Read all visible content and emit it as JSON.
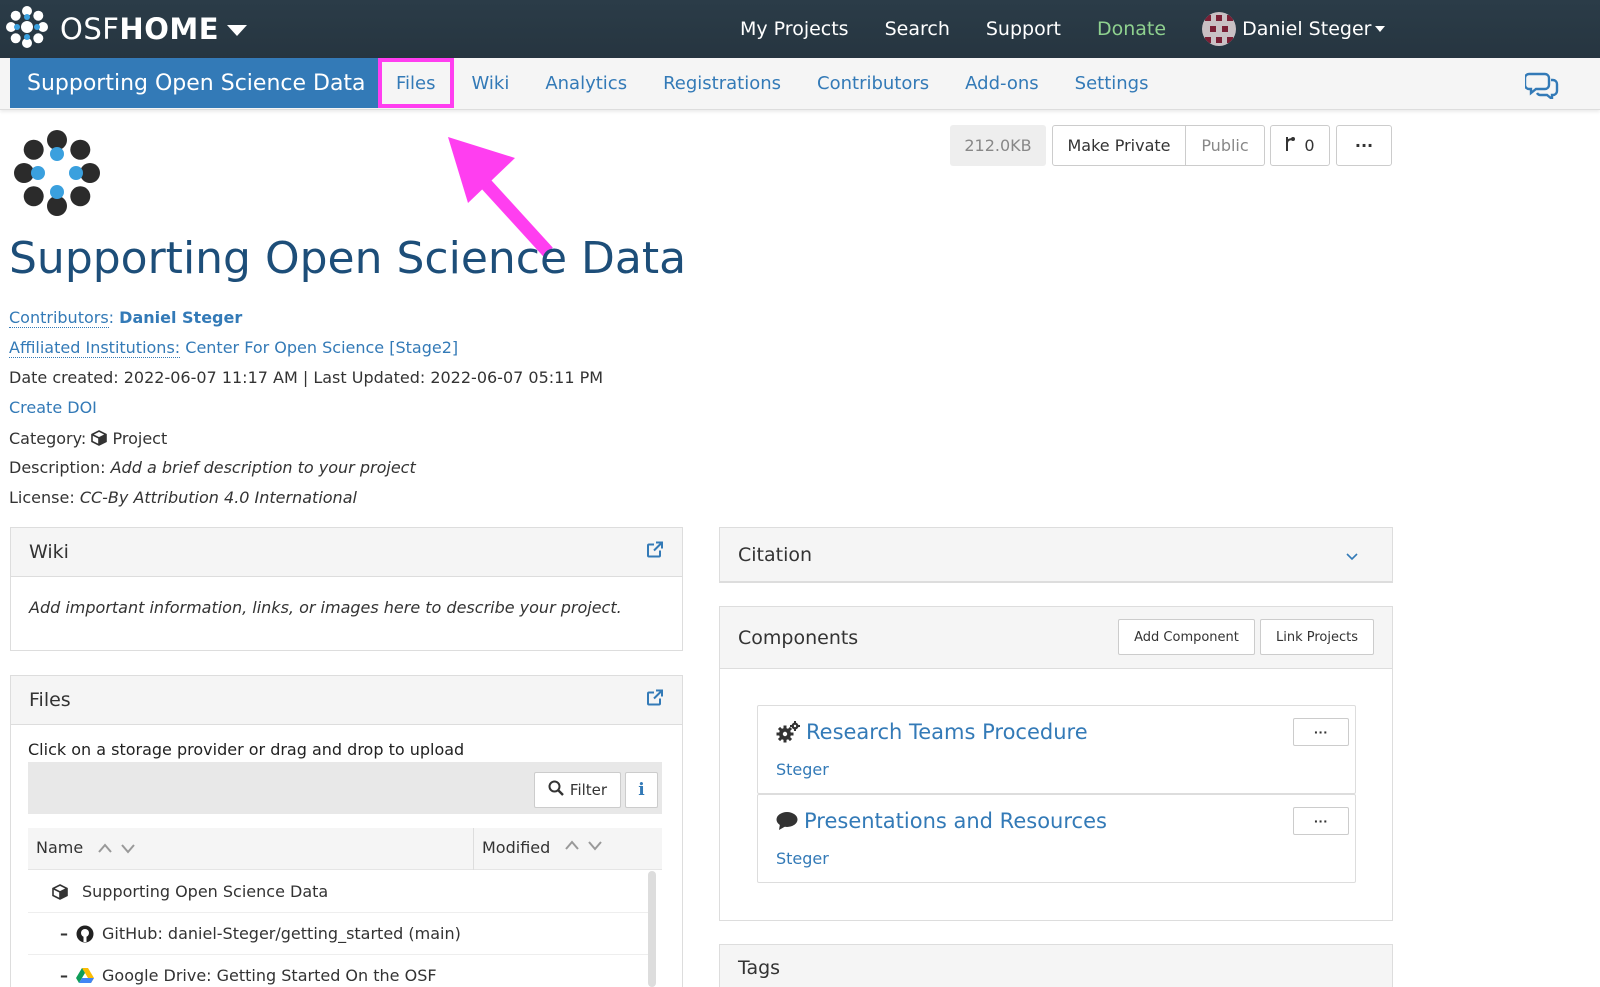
{
  "topnav": {
    "brand_light": "OSF",
    "brand_bold": "HOME",
    "links": [
      {
        "label": "My Projects"
      },
      {
        "label": "Search"
      },
      {
        "label": "Support"
      },
      {
        "label": "Donate"
      }
    ],
    "user_name": "Daniel Steger"
  },
  "project_nav": {
    "title": "Supporting Open Science Data",
    "tabs": [
      {
        "label": "Files"
      },
      {
        "label": "Wiki"
      },
      {
        "label": "Analytics"
      },
      {
        "label": "Registrations"
      },
      {
        "label": "Contributors"
      },
      {
        "label": "Add-ons"
      },
      {
        "label": "Settings"
      }
    ]
  },
  "toolbar": {
    "size": "212.0KB",
    "make_private": "Make Private",
    "public": "Public",
    "fork_count": "0",
    "more": "···"
  },
  "project": {
    "title": "Supporting Open Science Data",
    "contributors_label": "Contributors",
    "contributor_name": "Daniel Steger",
    "institutions_label": "Affiliated Institutions:",
    "institution": "Center For Open Science [Stage2]",
    "dates": "Date created: 2022-06-07 11:17 AM | Last Updated: 2022-06-07 05:11 PM",
    "create_doi": "Create DOI",
    "category_label": "Category:",
    "category": "Project",
    "description_label": "Description:",
    "description": "Add a brief description to your project",
    "license_label": "License:",
    "license": "CC-By Attribution 4.0 International"
  },
  "wiki_panel": {
    "title": "Wiki",
    "body": "Add important information, links, or images here to describe your project."
  },
  "files_panel": {
    "title": "Files",
    "hint": "Click on a storage provider or drag and drop to upload",
    "filter_label": "Filter",
    "col_name": "Name",
    "col_modified": "Modified",
    "rows": [
      {
        "label": "Supporting Open Science Data"
      },
      {
        "label": "GitHub: daniel-Steger/getting_started (main)"
      },
      {
        "label": "Google Drive: Getting Started On the OSF"
      }
    ]
  },
  "citation_panel": {
    "title": "Citation"
  },
  "components_panel": {
    "title": "Components",
    "add_component": "Add Component",
    "link_projects": "Link Projects",
    "items": [
      {
        "title": "Research Teams Procedure",
        "owner": "Steger"
      },
      {
        "title": "Presentations and Resources",
        "owner": "Steger"
      }
    ]
  },
  "tags_panel": {
    "title": "Tags"
  },
  "colors": {
    "topnav_bg": "#263540",
    "accent": "#337ab7",
    "highlight": "#ff3ef0",
    "donate": "#8fd18f"
  }
}
